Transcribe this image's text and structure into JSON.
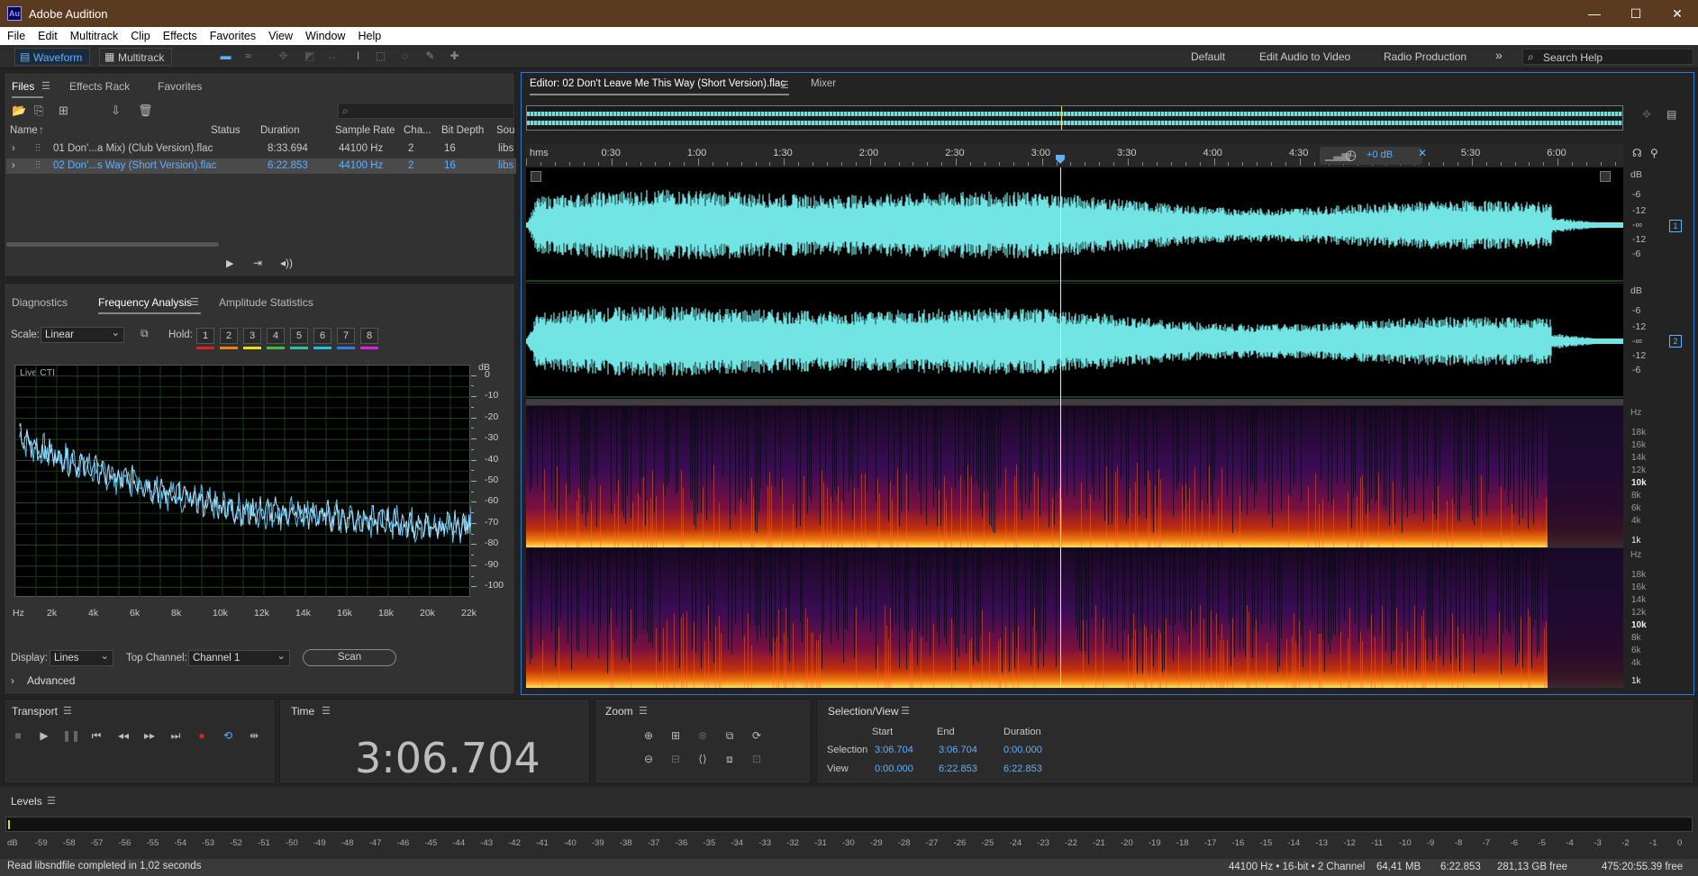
{
  "window": {
    "title": "Adobe Audition",
    "logo": "Au",
    "minimize": "—",
    "maximize": "☐",
    "close": "✕"
  },
  "menu": [
    "File",
    "Edit",
    "Multitrack",
    "Clip",
    "Effects",
    "Favorites",
    "View",
    "Window",
    "Help"
  ],
  "toolbar": {
    "waveform": "Waveform",
    "multitrack": "Multitrack",
    "workspaces": [
      "Default",
      "Edit Audio to Video",
      "Radio Production"
    ],
    "more": "»",
    "search_placeholder": "Search Help"
  },
  "files_panel": {
    "tabs": [
      "Files",
      "Effects Rack",
      "Favorites"
    ],
    "columns": [
      "Name",
      "Status",
      "Duration",
      "Sample Rate",
      "Cha...",
      "Bit Depth",
      "Sou"
    ],
    "rows": [
      {
        "name": "01 Don'...a Mix) (Club Version).flac",
        "status": "",
        "duration": "8:33.694",
        "rate": "44100 Hz",
        "ch": "2",
        "depth": "16",
        "src": "libs"
      },
      {
        "name": "02 Don'...s Way (Short Version).flac",
        "status": "",
        "duration": "6:22.853",
        "rate": "44100 Hz",
        "ch": "2",
        "depth": "16",
        "src": "libs"
      }
    ]
  },
  "analysis_panel": {
    "tabs": [
      "Diagnostics",
      "Frequency Analysis",
      "Amplitude Statistics"
    ],
    "scale_label": "Scale:",
    "scale_value": "Linear",
    "hold_label": "Hold:",
    "hold": [
      "1",
      "2",
      "3",
      "4",
      "5",
      "6",
      "7",
      "8"
    ],
    "hold_colors": [
      "#e02020",
      "#f08010",
      "#e8e010",
      "#40c040",
      "#30c0a0",
      "#20c0e0",
      "#3080e0",
      "#e020e0"
    ],
    "live_label": "Live CTI",
    "db_ticks": [
      "dB",
      "0",
      "-10",
      "-20",
      "-30",
      "-40",
      "-50",
      "-60",
      "-70",
      "-80",
      "-90",
      "-100"
    ],
    "hz_ticks": [
      "Hz",
      "2k",
      "4k",
      "6k",
      "8k",
      "10k",
      "12k",
      "14k",
      "16k",
      "18k",
      "20k",
      "22k"
    ],
    "display_label": "Display:",
    "display_value": "Lines",
    "top_channel_label": "Top Channel:",
    "top_channel_value": "Channel 1",
    "scan": "Scan",
    "advanced": "Advanced",
    "chart_data": {
      "type": "line",
      "x": [
        0.2,
        1,
        2,
        3,
        4,
        5,
        6,
        7,
        8,
        9,
        10,
        11,
        12,
        13,
        14,
        15,
        16,
        17,
        18,
        19,
        20,
        21,
        22
      ],
      "values": [
        -29,
        -34,
        -38,
        -41,
        -45,
        -49,
        -50,
        -54,
        -57,
        -60,
        -62,
        -64,
        -64,
        -65,
        -66,
        -66,
        -67,
        -68,
        -69,
        -70,
        -72,
        -71,
        -70
      ],
      "xlim": [
        0,
        22
      ],
      "ylim": [
        -105,
        5
      ]
    }
  },
  "editor": {
    "tab": "Editor: 02 Don't Leave Me This Way (Short Version).flac",
    "mixer": "Mixer",
    "ruler_unit": "hms",
    "ruler": [
      "0:30",
      "1:00",
      "1:30",
      "2:00",
      "2:30",
      "3:00",
      "3:30",
      "4:00",
      "4:30",
      "5:30",
      "6:00"
    ],
    "gain": "+0 dB",
    "db_scale": [
      "dB",
      "-6",
      "-12",
      "-∞",
      "-12",
      "-6"
    ],
    "hz_scale": [
      "Hz",
      "18k",
      "16k",
      "14k",
      "12k",
      "10k",
      "8k",
      "6k",
      "4k",
      "1k"
    ],
    "channels": [
      "1",
      "2"
    ]
  },
  "transport": {
    "title": "Transport"
  },
  "time": {
    "title": "Time",
    "value": "3:06.704"
  },
  "zoom": {
    "title": "Zoom"
  },
  "selection": {
    "title": "Selection/View",
    "headers": [
      "Start",
      "End",
      "Duration"
    ],
    "selection_label": "Selection",
    "selection": [
      "3:06.704",
      "3:06.704",
      "0:00.000"
    ],
    "view_label": "View",
    "view": [
      "0:00.000",
      "6:22.853",
      "6:22.853"
    ]
  },
  "levels": {
    "title": "Levels",
    "scale": [
      "dB",
      "-59",
      "-58",
      "-57",
      "-56",
      "-55",
      "-54",
      "-53",
      "-52",
      "-51",
      "-50",
      "-49",
      "-48",
      "-47",
      "-46",
      "-45",
      "-44",
      "-43",
      "-42",
      "-41",
      "-40",
      "-39",
      "-38",
      "-37",
      "-36",
      "-35",
      "-34",
      "-33",
      "-32",
      "-31",
      "-30",
      "-29",
      "-28",
      "-27",
      "-26",
      "-25",
      "-24",
      "-23",
      "-22",
      "-21",
      "-20",
      "-19",
      "-18",
      "-17",
      "-16",
      "-15",
      "-14",
      "-13",
      "-12",
      "-11",
      "-10",
      "-9",
      "-8",
      "-7",
      "-6",
      "-5",
      "-4",
      "-3",
      "-2",
      "-1",
      "0"
    ]
  },
  "status": {
    "message": "Read libsndfile completed in 1,02 seconds",
    "format": "44100 Hz • 16-bit • 2 Channel",
    "size": "64,41 MB",
    "duration": "6:22.853",
    "free": "281,13 GB free",
    "free_time": "475:20:55.39 free"
  }
}
